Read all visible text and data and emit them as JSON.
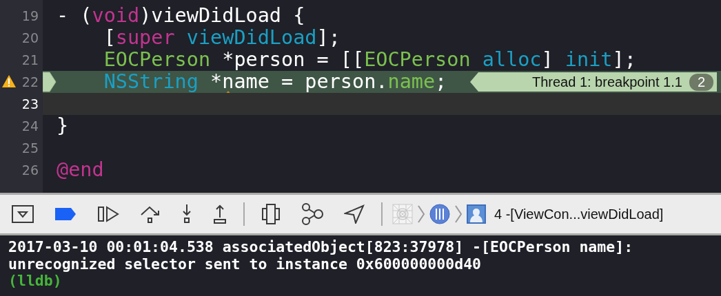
{
  "editor": {
    "lines": [
      {
        "number": "19",
        "warning": false,
        "breakpoint": false,
        "current": false,
        "tokens": [
          {
            "text": "- (",
            "kind": "plain"
          },
          {
            "text": "void",
            "kind": "keyword"
          },
          {
            "text": ")viewDidLoad {",
            "kind": "plain"
          }
        ],
        "children": [
          {
            "number": "20",
            "warning": false,
            "breakpoint": false,
            "current": false,
            "tokens": [
              {
                "text": "[",
                "kind": "plain"
              },
              {
                "text": "super ",
                "kind": "keyword"
              },
              {
                "text": "viewDidLoad",
                "kind": "method"
              },
              {
                "text": "];",
                "kind": "plain"
              }
            ]
          },
          {
            "number": "21",
            "warning": false,
            "breakpoint": false,
            "current": false,
            "tokens": [
              {
                "text": "EOCPerson",
                "kind": "type"
              },
              {
                "text": " *person = [[",
                "kind": "plain"
              },
              {
                "text": "EOCPerson ",
                "kind": "type"
              },
              {
                "text": "alloc",
                "kind": "method"
              },
              {
                "text": "] ",
                "kind": "plain"
              },
              {
                "text": "init",
                "kind": "method"
              },
              {
                "text": "];",
                "kind": "plain"
              }
            ]
          },
          {
            "number": "22",
            "warning": true,
            "breakpoint": true,
            "current": false,
            "tokens": [
              {
                "text": "NSString",
                "kind": "method"
              },
              {
                "text": " *",
                "kind": "plain"
              },
              {
                "text": "n",
                "kind": "plain",
                "warning_caret": true
              },
              {
                "text": "ame = person.",
                "kind": "plain"
              },
              {
                "text": "name",
                "kind": "type"
              },
              {
                "text": ";",
                "kind": "plain"
              }
            ],
            "annotation": {
              "text": "Thread 1: breakpoint 1.1",
              "count": "2"
            }
          },
          {
            "number": "23",
            "warning": false,
            "breakpoint": false,
            "current": true
          }
        ]
      },
      {
        "number": "24",
        "warning": false,
        "breakpoint": false,
        "current": false,
        "tokens": [
          {
            "text": "}",
            "kind": "plain"
          }
        ]
      },
      {
        "number": "25",
        "warning": false,
        "breakpoint": false,
        "current": false
      },
      {
        "number": "26",
        "warning": false,
        "breakpoint": false,
        "current": false,
        "tokens": [
          {
            "text": "@end",
            "kind": "keyword"
          }
        ]
      }
    ]
  },
  "debug_bar": {
    "breakpoints_active": true,
    "items": [
      {
        "kind": "hide"
      },
      {
        "kind": "breakpoints"
      },
      {
        "kind": "continue"
      },
      {
        "kind": "step_over"
      },
      {
        "kind": "step_into"
      },
      {
        "kind": "step_out"
      },
      {
        "kind": "separator"
      },
      {
        "kind": "view_debug"
      },
      {
        "kind": "memory_graph"
      },
      {
        "kind": "location"
      },
      {
        "kind": "separator"
      }
    ],
    "breadcrumb": [
      {
        "kind": "app"
      },
      {
        "kind": "thread"
      },
      {
        "kind": "frame",
        "label": "4 -[ViewCon...viewDidLoad]"
      }
    ]
  },
  "console": {
    "lines": [
      {
        "text": "2017-03-10 00:01:04.538 associatedObject[823:37978] -[EOCPerson name]:",
        "kind": "output"
      },
      {
        "text": "unrecognized selector sent to instance 0x600000000d40",
        "kind": "output"
      },
      {
        "text": "(lldb)",
        "kind": "prompt"
      }
    ]
  }
}
